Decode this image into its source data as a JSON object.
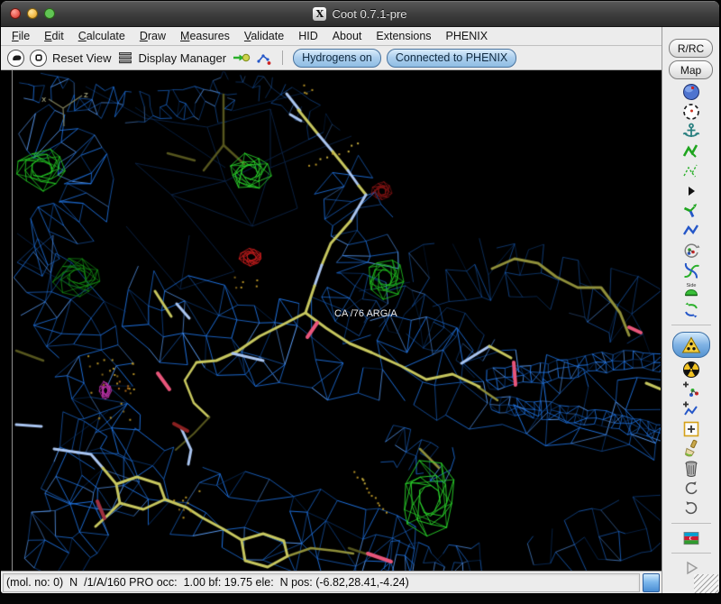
{
  "window": {
    "title": "Coot 0.7.1-pre",
    "window_controls": [
      "close",
      "minimize",
      "zoom"
    ]
  },
  "menu_bar": {
    "items": [
      {
        "label": "File",
        "underline": true
      },
      {
        "label": "Edit",
        "underline": true
      },
      {
        "label": "Calculate",
        "underline": true
      },
      {
        "label": "Draw",
        "underline": true
      },
      {
        "label": "Measures",
        "underline": true
      },
      {
        "label": "Validate",
        "underline": true
      },
      {
        "label": "HID",
        "underline": false
      },
      {
        "label": "About",
        "underline": false
      },
      {
        "label": "Extensions",
        "underline": false
      },
      {
        "label": "PHENIX",
        "underline": false
      }
    ]
  },
  "toolbar": {
    "items": [
      {
        "type": "icon-button",
        "icon": "half-disc"
      },
      {
        "type": "icon-button",
        "icon": "small-square"
      },
      {
        "type": "label",
        "text": "Reset View",
        "for": "reset-view"
      },
      {
        "type": "icon-button",
        "icon": "layer-stack"
      },
      {
        "type": "label",
        "text": "Display Manager",
        "for": "display-manager"
      },
      {
        "type": "icon-button",
        "icon": "green-arrow-ball"
      },
      {
        "type": "icon-button",
        "icon": "molecule"
      },
      {
        "type": "separator"
      },
      {
        "type": "toggle",
        "label": "Hydrogens on"
      },
      {
        "type": "toggle",
        "label": "Connected to PHENIX"
      }
    ]
  },
  "right_panel": {
    "buttons": [
      {
        "label": "R/RC"
      },
      {
        "label": "Map"
      }
    ],
    "tools": [
      {
        "name": "blue-sphere"
      },
      {
        "name": "dashed-target"
      },
      {
        "name": "anchor"
      },
      {
        "name": "green-zigzag"
      },
      {
        "name": "green-dashed-zigzag"
      },
      {
        "name": "play-triangle"
      },
      {
        "name": "bent-bond"
      },
      {
        "name": "blue-zigzag"
      },
      {
        "name": "rotate-fragment"
      },
      {
        "name": "pinwheel"
      },
      {
        "name": "side-chain-sphere",
        "label": "Side"
      },
      {
        "name": "swirl-arrows"
      },
      {
        "separator": true
      },
      {
        "name": "warning-triangle",
        "active": true
      },
      {
        "name": "radiation-trefoil"
      },
      {
        "name": "add-molecule"
      },
      {
        "name": "add-zigzag"
      },
      {
        "name": "add-box"
      },
      {
        "name": "paintbrush"
      },
      {
        "name": "trash-can"
      },
      {
        "name": "undo-arrow"
      },
      {
        "name": "redo-arrow"
      },
      {
        "separator": true
      },
      {
        "name": "flag"
      },
      {
        "separator": true
      },
      {
        "name": "play-outline",
        "disabled": true
      }
    ]
  },
  "canvas": {
    "atom_label": "CA /76 ARG/A",
    "axes": {
      "x": "x",
      "z": "z"
    },
    "colors": {
      "background": "#000000",
      "mesh": "#1f74e4",
      "mesh_hi": "#5ea3ff",
      "mesh_lo": "#0c3a78",
      "mesh_dim": "#0b2347",
      "model": "#c6c65e",
      "model_alt": "#a9c4ef",
      "model_dim": "#8f8f3a",
      "model_faint": "#56561e",
      "density_positive": "#24cc24",
      "density_negative": "#c41c1c",
      "marker_pink": "#e8557a",
      "marker_maroon": "#a03040",
      "marker_magenta": "#bb33aa",
      "waters": "#c09a28",
      "axes_color": "#80805c",
      "label_color": "#ececec"
    }
  },
  "status_bar": {
    "text": "(mol. no: 0)  N  /1/A/160 PRO occ:  1.00 bf: 19.75 ele:  N pos: (-6.82,28.41,-4.24)"
  }
}
